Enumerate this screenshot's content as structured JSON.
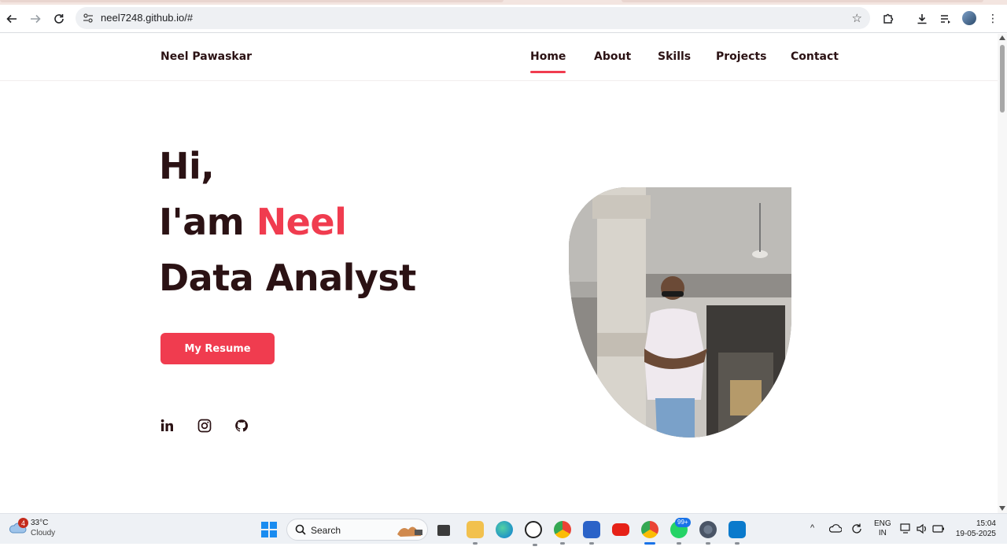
{
  "browser": {
    "url": "neel7248.github.io/#"
  },
  "nav": {
    "brand": "Neel Pawaskar",
    "items": [
      "Home",
      "About",
      "Skills",
      "Projects",
      "Contact"
    ],
    "active": "Home"
  },
  "hero": {
    "greeting": "Hi,",
    "intro_prefix": "I'am ",
    "name": "Neel",
    "role": "Data Analyst",
    "resume_button": "My Resume",
    "social_icons": [
      "linkedin-icon",
      "instagram-icon",
      "github-icon"
    ]
  },
  "colors": {
    "accent": "#f03c4f",
    "text_dark": "#2b1214"
  },
  "taskbar": {
    "weather_badge": "4",
    "weather_temp": "33°C",
    "weather_condition": "Cloudy",
    "search_label": "Search",
    "badge_whatsapp": "99+",
    "lang_line1": "ENG",
    "lang_line2": "IN",
    "time": "15:04",
    "date": "19-05-2025"
  }
}
